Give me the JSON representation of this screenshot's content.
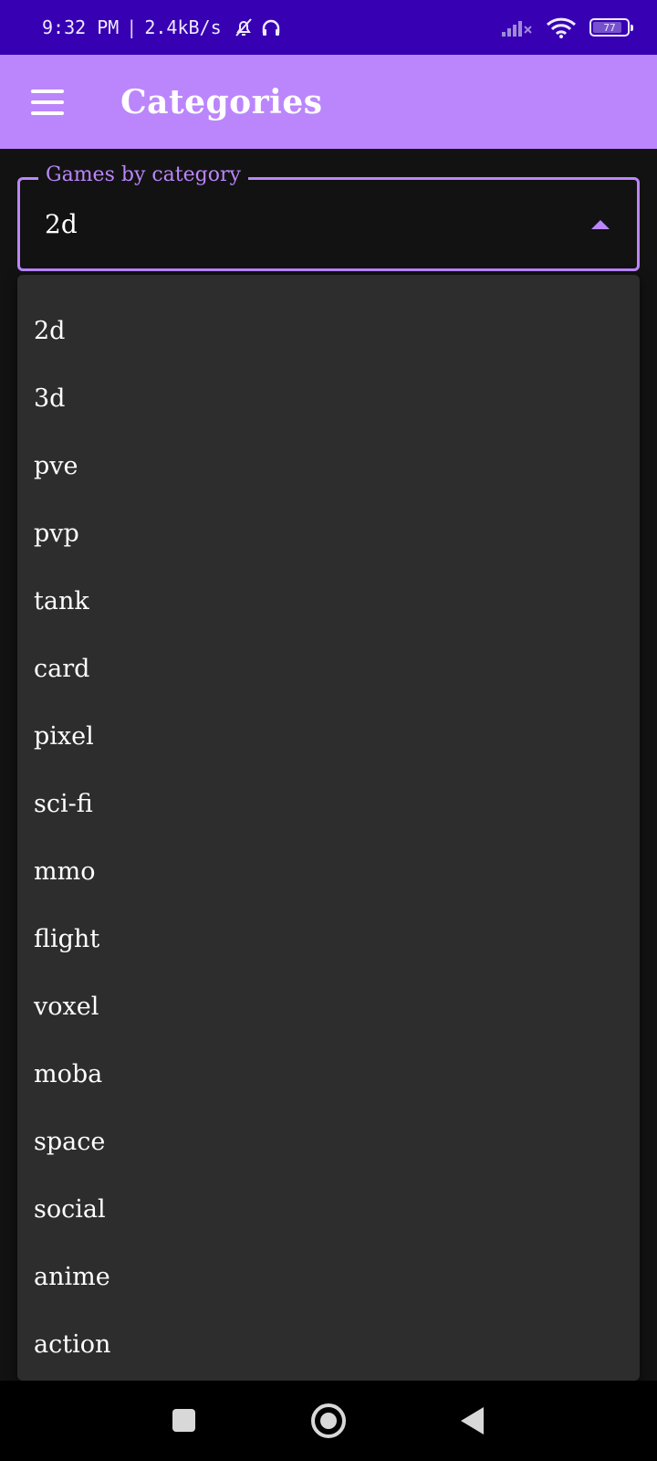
{
  "status_bar": {
    "time": "9:32 PM",
    "separator": "|",
    "speed": "2.4kB/s",
    "icons": [
      "bell-off-icon",
      "headphones-icon",
      "signal-icon",
      "wifi-icon"
    ],
    "battery": "77"
  },
  "app_bar": {
    "title": "Categories"
  },
  "select": {
    "label": "Games by category",
    "value": "2d"
  },
  "dropdown": {
    "items": [
      "2d",
      "3d",
      "pve",
      "pvp",
      "tank",
      "card",
      "pixel",
      "sci-fi",
      "mmo",
      "flight",
      "voxel",
      "moba",
      "space",
      "social",
      "anime",
      "action"
    ]
  },
  "colors": {
    "status_bar": "#3700b3",
    "app_bar": "#bb86fc",
    "accent": "#bb86fc",
    "background": "#121212",
    "menu_surface": "#2d2d2d"
  }
}
